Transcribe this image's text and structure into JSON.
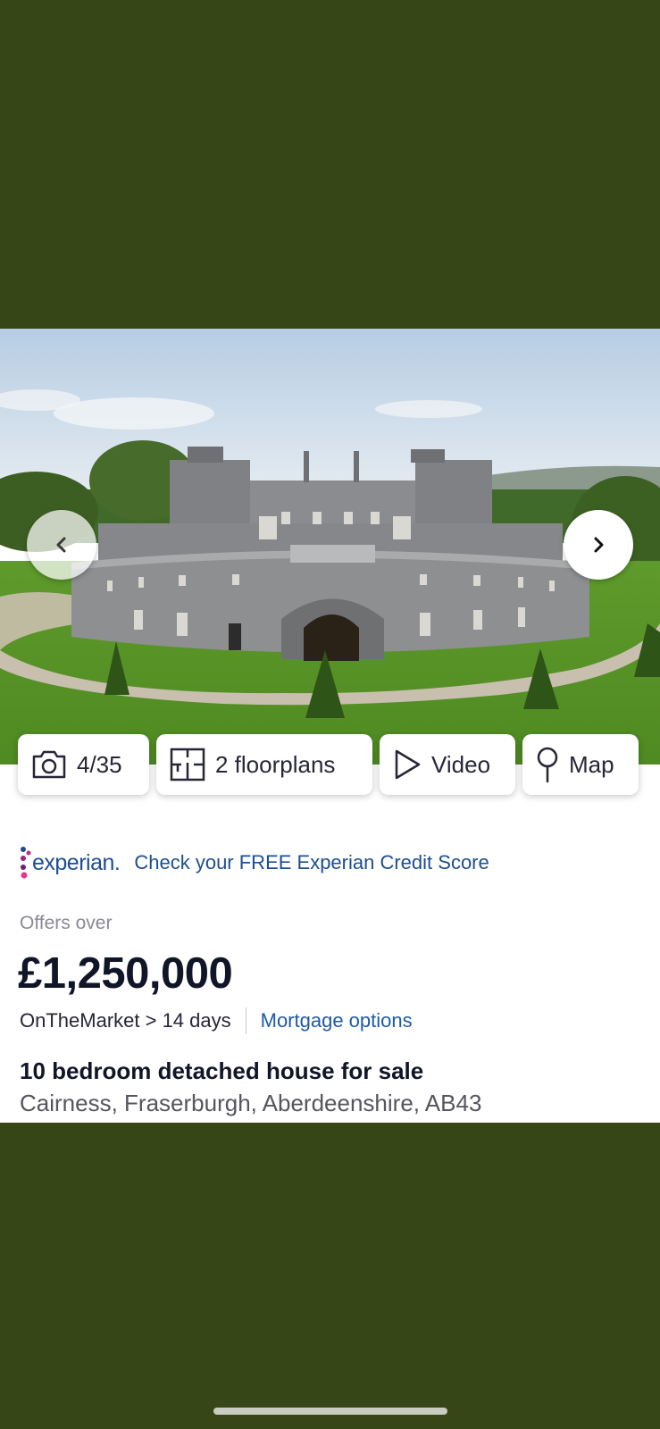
{
  "gallery": {
    "photo_count": "4/35",
    "floorplans_label": "2 floorplans",
    "video_label": "Video",
    "map_label": "Map"
  },
  "experian": {
    "logo_text": "experian.",
    "cta": "Check your FREE Experian Credit Score"
  },
  "listing": {
    "price_qualifier": "Offers over",
    "price": "£1,250,000",
    "source": "OnTheMarket > 14 days",
    "mortgage_link": "Mortgage options",
    "title": "10 bedroom detached house for sale",
    "address": "Cairness, Fraserburgh, Aberdeenshire, AB43"
  },
  "colors": {
    "background": "#364616",
    "link_blue": "#1d5aa6",
    "experian_blue": "#1d4f91",
    "price_text": "#111528"
  },
  "icons": [
    "chevron-left-icon",
    "chevron-right-icon",
    "camera-icon",
    "floorplan-icon",
    "play-icon",
    "map-pin-icon"
  ]
}
